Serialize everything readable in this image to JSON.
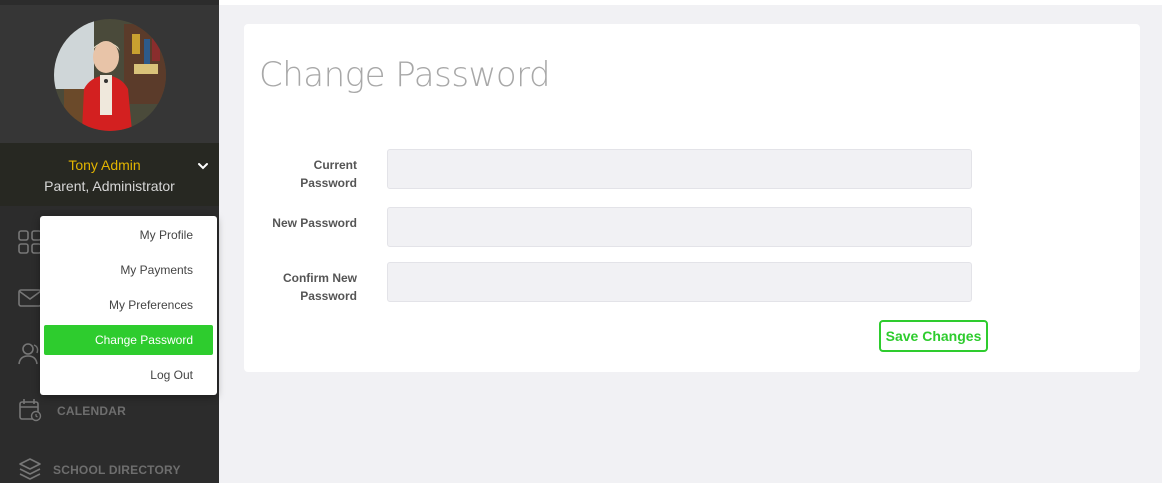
{
  "user": {
    "name": "Tony Admin",
    "role": "Parent, Administrator"
  },
  "nav": {
    "items": [
      {
        "label": "",
        "icon": "dashboard-grid-icon"
      },
      {
        "label": "",
        "icon": "mail-icon"
      },
      {
        "label": "",
        "icon": "users-icon"
      },
      {
        "label": "CALENDAR",
        "icon": "calendar-icon"
      },
      {
        "label": "SCHOOL DIRECTORY",
        "icon": "layers-icon"
      }
    ]
  },
  "dropdown": {
    "items": [
      {
        "label": "My Profile"
      },
      {
        "label": "My Payments"
      },
      {
        "label": "My Preferences"
      },
      {
        "label": "Change Password",
        "active": true
      },
      {
        "label": "Log Out"
      }
    ]
  },
  "form": {
    "title": "Change Password",
    "fields": [
      {
        "label_line1": "Current",
        "label_line2": "Password",
        "value": ""
      },
      {
        "label_line1": "New Password",
        "label_line2": "",
        "value": ""
      },
      {
        "label_line1": "Confirm New",
        "label_line2": "Password",
        "value": ""
      }
    ],
    "save_label": "Save Changes"
  },
  "colors": {
    "accent": "#2ecc2e",
    "user_name": "#e2b400",
    "sidebar": "#2c2c2c"
  }
}
